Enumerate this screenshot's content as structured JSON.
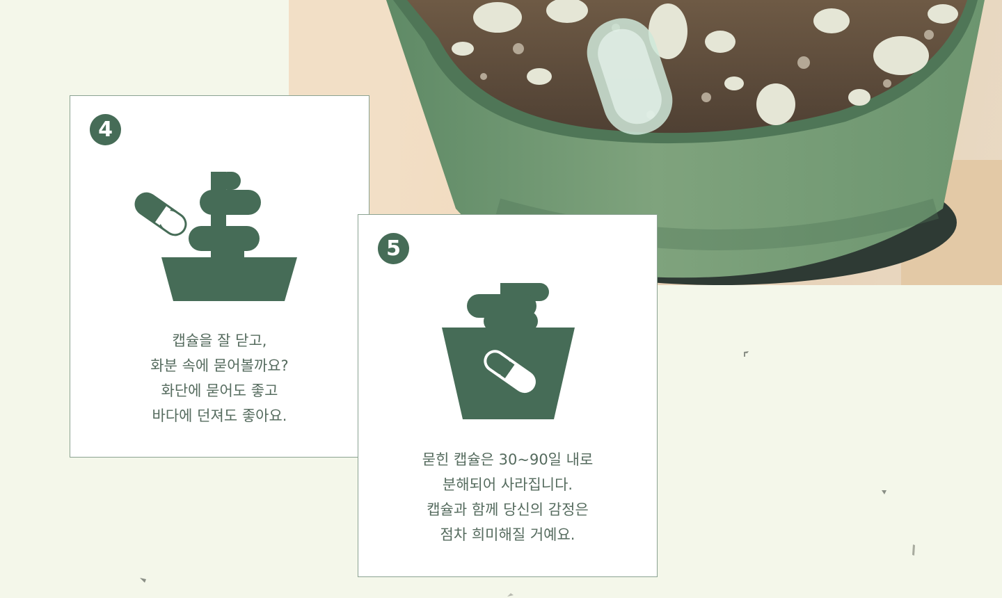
{
  "photo": {
    "icon": "plant-pot-capsule-photo"
  },
  "cards": [
    {
      "number": "4",
      "icon": "capsule-bury-icon",
      "lines": [
        "캡슐을 잘 닫고,",
        "화분 속에 묻어볼까요?",
        "화단에 묻어도 좋고",
        "바다에 던져도 좋아요."
      ]
    },
    {
      "number": "5",
      "icon": "capsule-decompose-icon",
      "lines": [
        "묻힌 캡슐은 30~90일 내로",
        "분해되어 사라집니다.",
        "캡슐과 함께 당신의 감정은",
        "점차 희미해질 거예요."
      ]
    }
  ],
  "colors": {
    "accent": "#466c57",
    "background": "#f4f7ea",
    "text": "#556b5e",
    "card": "#ffffff"
  }
}
